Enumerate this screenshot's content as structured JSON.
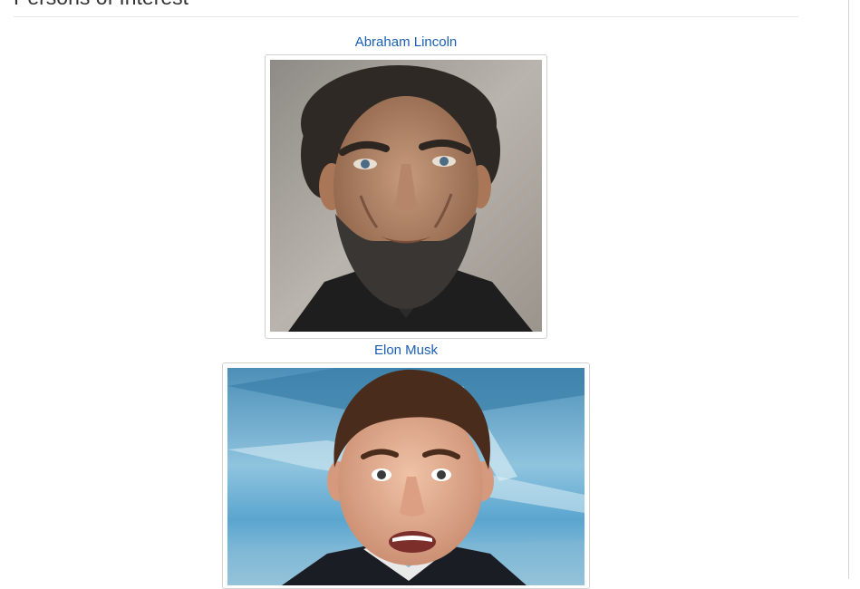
{
  "page": {
    "title": "Persons of Interest"
  },
  "persons": [
    {
      "name": "Abraham Lincoln",
      "image_icon": "portrait-photo-icon"
    },
    {
      "name": "Elon Musk",
      "image_icon": "portrait-photo-icon"
    }
  ],
  "colors": {
    "link": "#1a5fb4",
    "title": "#333333",
    "divider": "#e6e6e6",
    "thumbnail_border": "#d0d0d0"
  }
}
